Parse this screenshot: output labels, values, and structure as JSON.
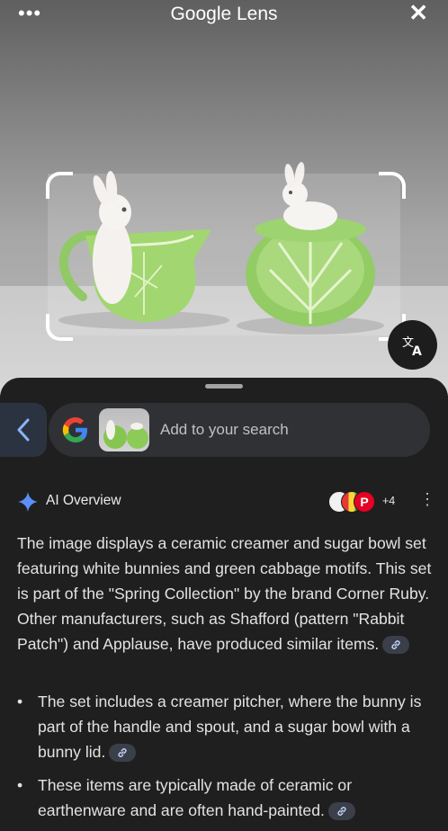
{
  "header": {
    "app_title": "Google Lens",
    "menu_icon": "more-horiz-icon",
    "close_icon": "close-icon"
  },
  "photo": {
    "subject": "ceramic creamer and sugar bowl with bunnies and cabbage leaves"
  },
  "search": {
    "back_icon": "chevron-left-icon",
    "placeholder": "Add to your search"
  },
  "ai_overview": {
    "title": "AI Overview",
    "source_count": "+4",
    "summary": "The image displays a ceramic creamer and sugar bowl set featuring white bunnies and green cabbage motifs. This set is part of the \"Spring Collection\" by the brand Corner Ruby. Other manufacturers, such as Shafford (pattern \"Rabbit Patch\") and Applause, have produced similar items.",
    "bullets": [
      "The set includes a creamer pitcher, where the bunny is part of the handle and spout, and a sugar bowl with a bunny lid.",
      "These items are typically made of ceramic or earthenware and are often hand-painted."
    ]
  },
  "colors": {
    "background": "#1f1f1f",
    "pill": "#303134",
    "accent_blue": "#8ab4f8"
  }
}
